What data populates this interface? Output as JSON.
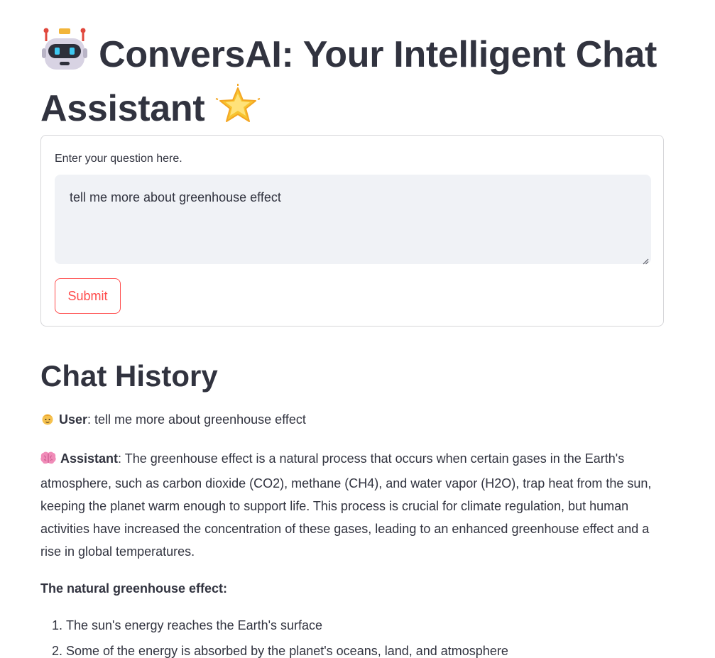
{
  "header": {
    "title": "ConversAI: Your Intelligent Chat Assistant",
    "title_prefix_icon": "robot-icon",
    "title_suffix_icon": "glowing-star-icon"
  },
  "form": {
    "label": "Enter your question here.",
    "input_value": "tell me more about greenhouse effect",
    "submit_label": "Submit"
  },
  "history": {
    "heading": "Chat History",
    "messages": [
      {
        "role": "User",
        "icon": "person-icon",
        "text": ": tell me more about greenhouse effect"
      },
      {
        "role": "Assistant",
        "icon": "brain-icon",
        "text": ": The greenhouse effect is a natural process that occurs when certain gases in the Earth's atmosphere, such as carbon dioxide (CO2), methane (CH4), and water vapor (H2O), trap heat from the sun, keeping the planet warm enough to support life. This process is crucial for climate regulation, but human activities have increased the concentration of these gases, leading to an enhanced greenhouse effect and a rise in global temperatures."
      }
    ],
    "section_heading": "The natural greenhouse effect:",
    "steps": [
      "The sun's energy reaches the Earth's surface",
      "Some of the energy is absorbed by the planet's oceans, land, and atmosphere"
    ]
  },
  "colors": {
    "accent": "#ff4b4b",
    "text": "#31333f",
    "input_bg": "#f0f2f6"
  }
}
